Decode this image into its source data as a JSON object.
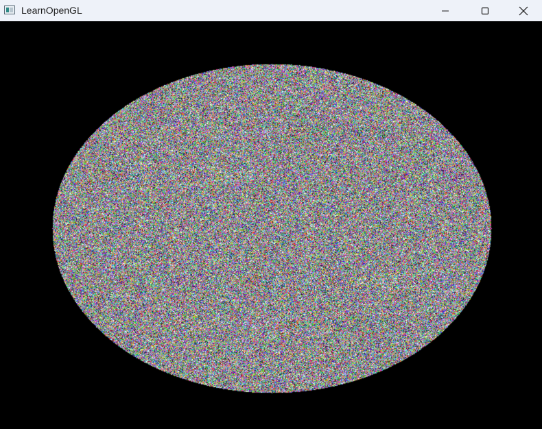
{
  "window": {
    "title": "LearnOpenGL",
    "app_icon": "opengl-window-icon",
    "controls": {
      "minimize_icon": "minimize-icon",
      "maximize_icon": "maximize-icon",
      "close_icon": "close-icon"
    }
  },
  "scene": {
    "background_color": "#000000",
    "shape": "ellipse",
    "fill": "random-color-noise"
  }
}
